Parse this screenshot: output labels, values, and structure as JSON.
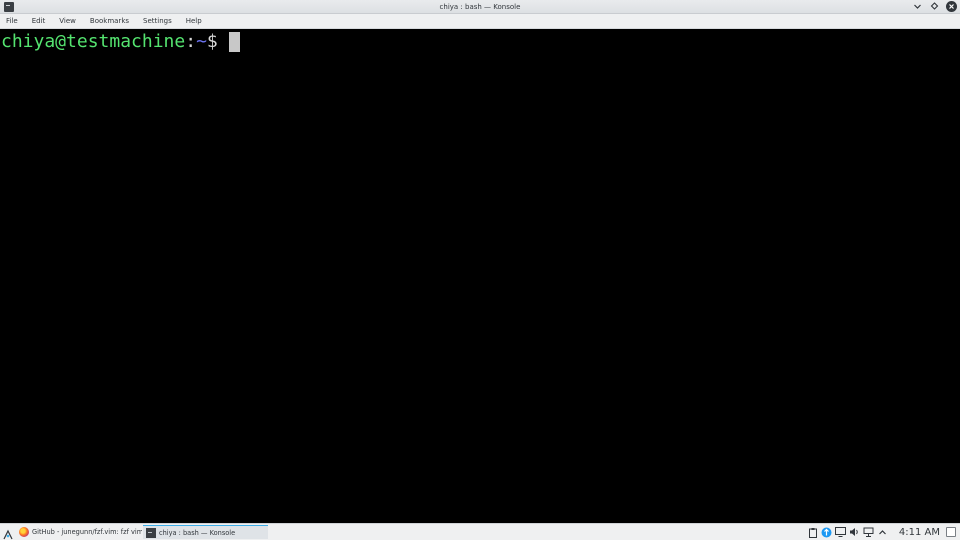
{
  "window": {
    "title": "chiya : bash — Konsole",
    "controls": [
      "chevron-down-icon",
      "pin-icon",
      "close-icon"
    ]
  },
  "menubar": {
    "items": [
      "File",
      "Edit",
      "View",
      "Bookmarks",
      "Settings",
      "Help"
    ]
  },
  "terminal": {
    "prompt_user_host": "chiya@testmachine",
    "prompt_colon": ":",
    "prompt_path": "~",
    "prompt_symbol": "$",
    "colors": {
      "background": "#000000",
      "user": "#54e36f",
      "path": "#6c73f0",
      "text": "#d8d8d8"
    }
  },
  "taskbar": {
    "tasks": [
      {
        "label": "GitHub - junegunn/fzf.vim: fzf vim…",
        "icon": "firefox-icon",
        "active": false
      },
      {
        "label": "chiya : bash — Konsole",
        "icon": "terminal-icon",
        "active": true
      }
    ],
    "tray_icons": [
      "clipboard-icon",
      "updates-icon",
      "display-icon",
      "volume-icon",
      "network-icon",
      "expand-icon"
    ],
    "clock": "4:11 AM"
  }
}
